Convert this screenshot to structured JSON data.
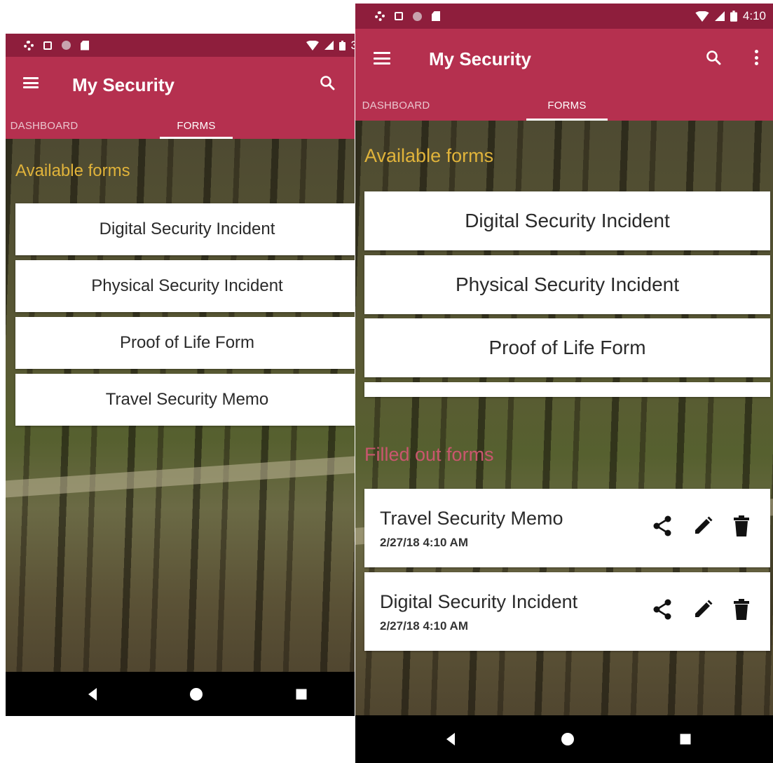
{
  "colors": {
    "status_bar": "#8e1e3c",
    "app_bar": "#b5304f",
    "available_title": "#e0b33a",
    "filled_title": "#c9566e"
  },
  "left_phone": {
    "status_time": "3",
    "app_title": "My Security",
    "tabs": [
      "DASHBOARD",
      "FORMS"
    ],
    "active_tab": "FORMS",
    "available_title": "Available forms",
    "available_forms": [
      "Digital Security Incident",
      "Physical Security Incident",
      "Proof of Life Form",
      "Travel Security Memo"
    ]
  },
  "right_phone": {
    "status_time": "4:10",
    "app_title": "My Security",
    "tabs": [
      "DASHBOARD",
      "FORMS"
    ],
    "active_tab": "FORMS",
    "available_title": "Available forms",
    "available_forms": [
      "Digital Security Incident",
      "Physical Security Incident",
      "Proof of Life Form"
    ],
    "filled_title": "Filled out forms",
    "filled_forms": [
      {
        "name": "Travel Security Memo",
        "date": "2/27/18 4:10 AM"
      },
      {
        "name": "Digital Security Incident",
        "date": "2/27/18 4:10 AM"
      }
    ]
  }
}
